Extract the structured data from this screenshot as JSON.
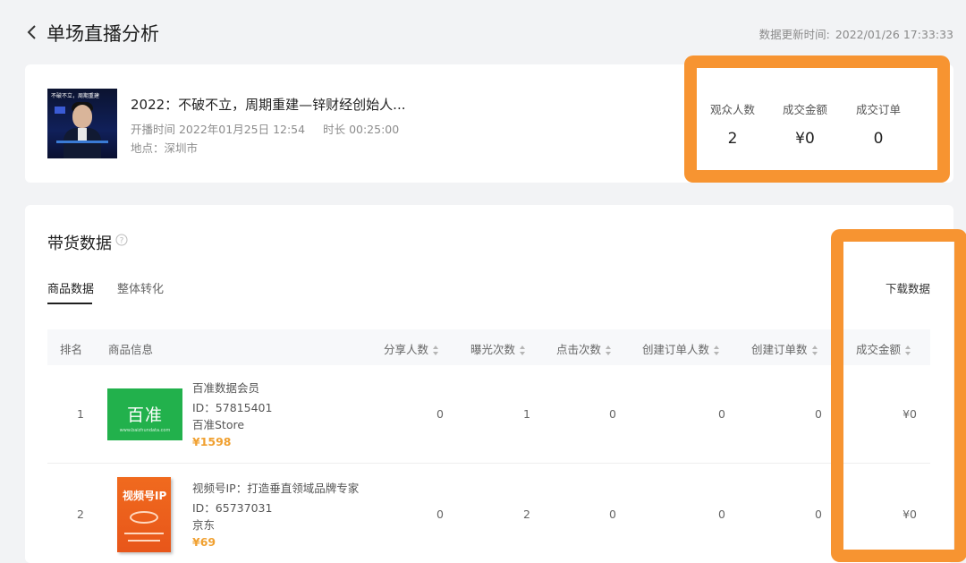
{
  "header": {
    "title": "单场直播分析",
    "update_label": "数据更新时间:",
    "update_time": "2022/01/26 17:33:33"
  },
  "live": {
    "thumb_caption": "不破不立，周期重建",
    "title": "2022：不破不立，周期重建—锌财经创始人...",
    "start_label": "开播时间 2022年01月25日 12:54",
    "duration_label": "时长 00:25:00",
    "location_label": "地点：深圳市"
  },
  "stats": [
    {
      "label": "观众人数",
      "value": "2"
    },
    {
      "label": "成交金额",
      "value": "¥0"
    },
    {
      "label": "成交订单",
      "value": "0"
    }
  ],
  "goods": {
    "section_title": "带货数据",
    "tabs": [
      "商品数据",
      "整体转化"
    ],
    "active_tab": 0,
    "download_label": "下载数据",
    "columns": [
      "排名",
      "商品信息",
      "分享人数",
      "曝光次数",
      "点击次数",
      "创建订单人数",
      "创建订单数",
      "成交金额"
    ],
    "rows": [
      {
        "rank": "1",
        "name": "百准数据会员",
        "id": "ID：57815401",
        "store": "百准Store",
        "price": "¥1598",
        "image_text": "百准",
        "image_sub": "www.baizhundata.com",
        "share": "0",
        "exposure": "1",
        "clicks": "0",
        "order_users": "0",
        "orders": "0",
        "amount": "¥0"
      },
      {
        "rank": "2",
        "name": "视频号IP：打造垂直领域品牌专家",
        "id": "ID：65737031",
        "store": "京东",
        "price": "¥69",
        "image_text": "视频号IP",
        "share": "0",
        "exposure": "2",
        "clicks": "0",
        "order_users": "0",
        "orders": "0",
        "amount": "¥0"
      }
    ]
  },
  "colors": {
    "highlight": "#f79431",
    "price": "#f0a030",
    "brand_green": "#22b14c",
    "book_orange": "#e8561a"
  }
}
